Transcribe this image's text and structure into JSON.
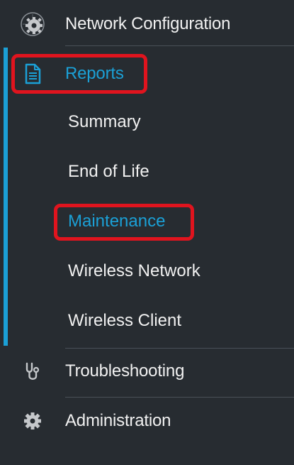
{
  "sidebar": {
    "items": [
      {
        "label": "Network Configuration",
        "icon": "network-gear-icon"
      },
      {
        "label": "Reports",
        "icon": "document-icon",
        "active": true
      },
      {
        "label": "Troubleshooting",
        "icon": "stethoscope-icon"
      },
      {
        "label": "Administration",
        "icon": "gear-icon"
      }
    ],
    "reports_submenu": [
      {
        "label": "Summary"
      },
      {
        "label": "End of Life"
      },
      {
        "label": "Maintenance",
        "active": true
      },
      {
        "label": "Wireless Network"
      },
      {
        "label": "Wireless Client"
      }
    ]
  },
  "colors": {
    "background": "#272c31",
    "text": "#f1f1f1",
    "active_text": "#1ba0d6",
    "accent_bar": "#1ba0d6",
    "highlight_box": "#e0141e",
    "icon": "#c5c8cb"
  }
}
